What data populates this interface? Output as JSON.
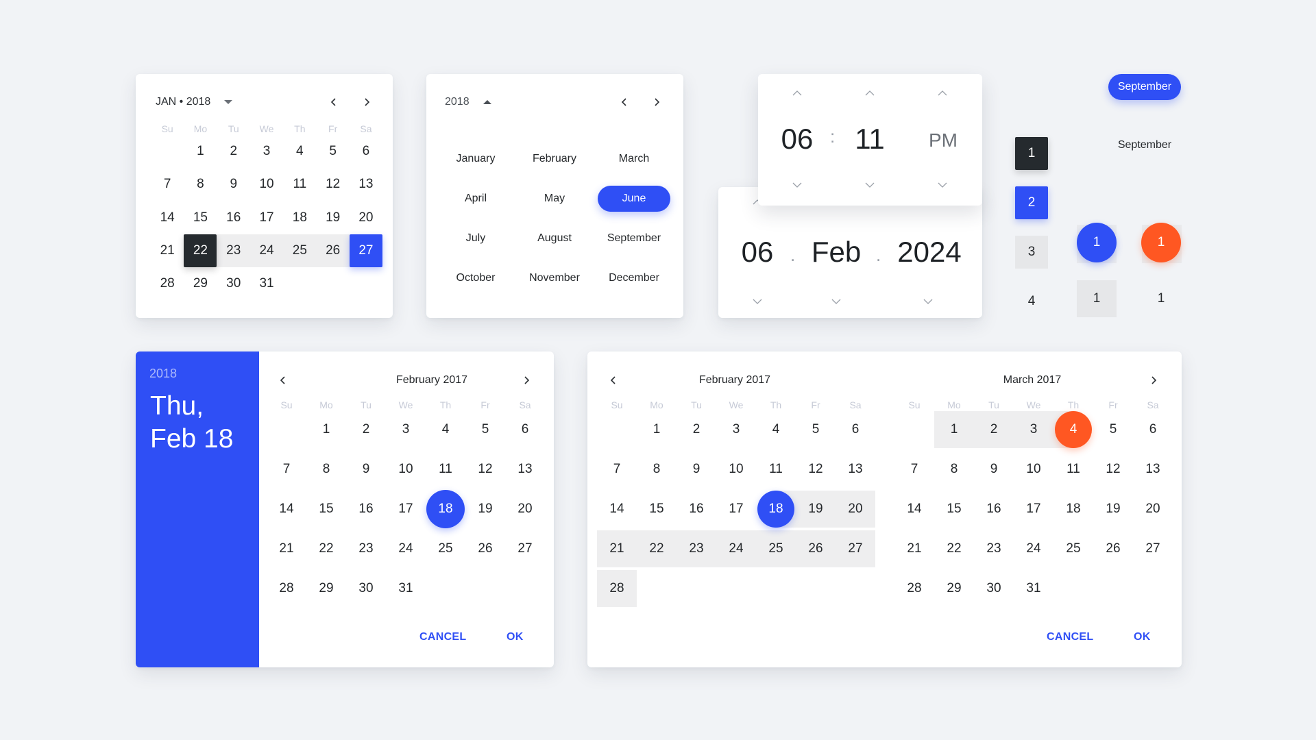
{
  "colors": {
    "accent_blue": "#2f4ff5",
    "accent_orange": "#ff5722",
    "dark": "#252a2e",
    "range_gray": "#eeeeef",
    "background": "#f1f3f6"
  },
  "weekdays": [
    "Su",
    "Mo",
    "Tu",
    "We",
    "Th",
    "Fr",
    "Sa"
  ],
  "range_calendar_small": {
    "header_label": "JAN • 2018",
    "dropdown_icon": "caret-down-icon",
    "prev_icon": "chevron-left-icon",
    "next_icon": "chevron-right-icon",
    "first_weekday_offset": 1,
    "days_in_month": 31,
    "range_start": 22,
    "range_end": 27
  },
  "month_picker": {
    "year_label": "2018",
    "toggle_icon": "caret-up-icon",
    "months": [
      "January",
      "February",
      "March",
      "April",
      "May",
      "June",
      "July",
      "August",
      "September",
      "October",
      "November",
      "December"
    ],
    "selected_month": "June"
  },
  "time_picker": {
    "hour": "06",
    "separator": ":",
    "minute": "11",
    "period": "PM"
  },
  "date_scroller": {
    "day": "06",
    "month": "Feb",
    "year": "2024",
    "separator": "."
  },
  "samples": {
    "pill_label": "September",
    "plain_label": "September",
    "square_dark": "1",
    "square_blue": "2",
    "square_gray": "3",
    "square_plain": "4",
    "circle_blue": "1",
    "circle_orange": "1",
    "square_gray_2": "1",
    "plain_2": "1"
  },
  "single_date_dialog": {
    "year": "2018",
    "date_line_1": "Thu,",
    "date_line_2": "Feb 18",
    "month_title": "February 2017",
    "first_weekday_offset": 1,
    "days_in_month": 31,
    "selected_day": 18,
    "cancel_label": "CANCEL",
    "ok_label": "OK"
  },
  "range_dialog": {
    "left_title": "February 2017",
    "right_title": "March 2017",
    "left_first_weekday_offset": 1,
    "left_days_in_month": 28,
    "right_first_weekday_offset": 1,
    "right_days_in_month": 31,
    "range_start": "Feb 18",
    "range_end": "Mar 4",
    "cancel_label": "CANCEL",
    "ok_label": "OK"
  }
}
